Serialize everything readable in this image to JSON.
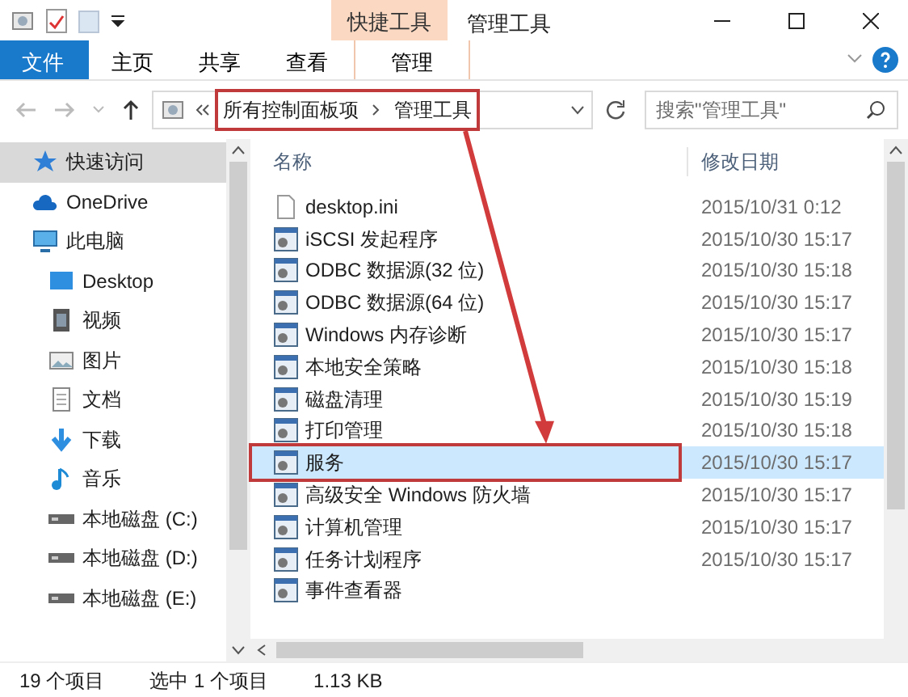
{
  "window": {
    "title": "管理工具",
    "context_group": "快捷工具"
  },
  "ribbon_tabs": [
    {
      "label": "文件",
      "kind": "file"
    },
    {
      "label": "主页",
      "kind": "plain"
    },
    {
      "label": "共享",
      "kind": "plain"
    },
    {
      "label": "查看",
      "kind": "plain"
    },
    {
      "label": "管理",
      "kind": "context"
    }
  ],
  "address_bar": {
    "path": [
      "所有控制面板项",
      "管理工具"
    ],
    "annotated": true
  },
  "search": {
    "placeholder": "搜索\"管理工具\""
  },
  "sidebar": {
    "items": [
      {
        "label": "快速访问",
        "kind": "quick",
        "selected": true
      },
      {
        "label": "OneDrive",
        "kind": "cloud",
        "selected": false
      },
      {
        "label": "此电脑",
        "kind": "computer",
        "selected": false,
        "children": [
          {
            "label": "Desktop",
            "kind": "desktop",
            "selected": false
          },
          {
            "label": "视频",
            "kind": "video",
            "selected": false
          },
          {
            "label": "图片",
            "kind": "pictures",
            "selected": false
          },
          {
            "label": "文档",
            "kind": "documents",
            "selected": false
          },
          {
            "label": "下载",
            "kind": "downloads",
            "selected": false
          },
          {
            "label": "音乐",
            "kind": "music",
            "selected": false
          },
          {
            "label": "本地磁盘 (C:)",
            "kind": "drive",
            "selected": false
          },
          {
            "label": "本地磁盘 (D:)",
            "kind": "drive",
            "selected": false
          },
          {
            "label": "本地磁盘 (E:)",
            "kind": "drive",
            "selected": false
          }
        ]
      }
    ]
  },
  "table": {
    "columns": [
      "名称",
      "修改日期"
    ],
    "rows": [
      {
        "name": "desktop.ini",
        "modified": "2015/10/31 0:12",
        "kind": "file",
        "selected": false,
        "annotated": false
      },
      {
        "name": "iSCSI 发起程序",
        "modified": "2015/10/30 15:17",
        "kind": "tool",
        "selected": false,
        "annotated": false
      },
      {
        "name": "ODBC 数据源(32 位)",
        "modified": "2015/10/30 15:18",
        "kind": "tool",
        "selected": false,
        "annotated": false
      },
      {
        "name": "ODBC 数据源(64 位)",
        "modified": "2015/10/30 15:17",
        "kind": "tool",
        "selected": false,
        "annotated": false
      },
      {
        "name": "Windows 内存诊断",
        "modified": "2015/10/30 15:17",
        "kind": "tool",
        "selected": false,
        "annotated": false
      },
      {
        "name": "本地安全策略",
        "modified": "2015/10/30 15:18",
        "kind": "tool",
        "selected": false,
        "annotated": false
      },
      {
        "name": "磁盘清理",
        "modified": "2015/10/30 15:19",
        "kind": "tool",
        "selected": false,
        "annotated": false
      },
      {
        "name": "打印管理",
        "modified": "2015/10/30 15:18",
        "kind": "tool",
        "selected": false,
        "annotated": false
      },
      {
        "name": "服务",
        "modified": "2015/10/30 15:17",
        "kind": "tool",
        "selected": true,
        "annotated": true
      },
      {
        "name": "高级安全 Windows 防火墙",
        "modified": "2015/10/30 15:17",
        "kind": "tool",
        "selected": false,
        "annotated": false
      },
      {
        "name": "计算机管理",
        "modified": "2015/10/30 15:17",
        "kind": "tool",
        "selected": false,
        "annotated": false
      },
      {
        "name": "任务计划程序",
        "modified": "2015/10/30 15:17",
        "kind": "tool",
        "selected": false,
        "annotated": false
      },
      {
        "name": "事件查看器",
        "modified": "",
        "kind": "tool",
        "selected": false,
        "annotated": false
      }
    ]
  },
  "status_bar": [
    "19 个项目",
    "选中 1 个项目",
    "1.13 KB"
  ]
}
